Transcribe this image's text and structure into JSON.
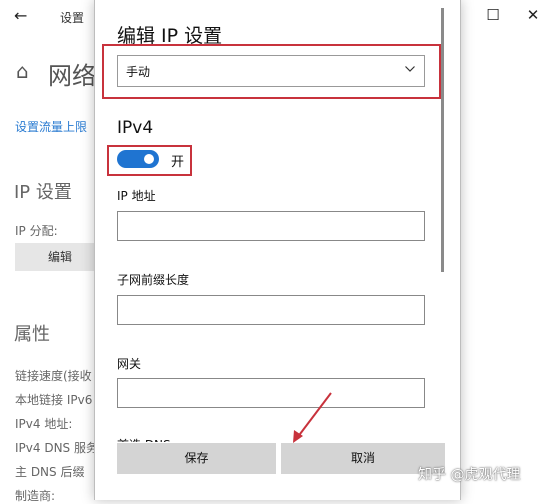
{
  "background": {
    "title": "设置",
    "heading": "网络",
    "link": "设置流量上限",
    "ip_section": "IP 设置",
    "ip_assign_label": "IP 分配:",
    "edit_button": "编辑",
    "properties": "属性",
    "props": [
      "链接速度(接收",
      "本地链接 IPv6",
      "IPv4 地址:",
      "IPv4 DNS 服务",
      "主 DNS 后缀",
      "制造商:"
    ]
  },
  "dialog": {
    "title": "编辑 IP 设置",
    "mode_value": "手动",
    "ipv4_heading": "IPv4",
    "toggle_label": "开",
    "toggle_on": true,
    "fields": [
      {
        "label": "IP 地址",
        "value": ""
      },
      {
        "label": "子网前缀长度",
        "value": ""
      },
      {
        "label": "网关",
        "value": ""
      }
    ],
    "dns_partial": "首选 DNS",
    "save_label": "保存",
    "cancel_label": "取消"
  },
  "watermark": "知乎 @虎观代理",
  "colors": {
    "accent": "#1f74d1",
    "highlight_border": "#c8323c",
    "link": "#2a7bd1"
  },
  "icons": [
    "back-arrow-icon",
    "home-icon",
    "minimize-icon",
    "maximize-icon",
    "close-icon",
    "chevron-down-icon",
    "annotation-arrow-icon"
  ]
}
